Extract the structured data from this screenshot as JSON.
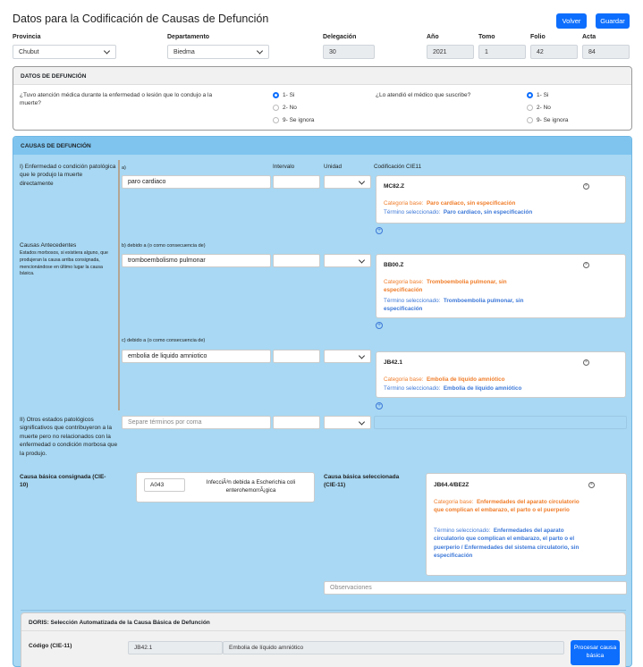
{
  "header": {
    "title": "Datos para la Codificación de Causas de Defunción",
    "volver": "Volver",
    "guardar": "Guardar"
  },
  "top_fields": {
    "provincia": {
      "label": "Provincia",
      "value": "Chubut"
    },
    "departamento": {
      "label": "Departamento",
      "value": "Biedma"
    },
    "delegacion": {
      "label": "Delegación",
      "value": "30"
    },
    "anio": {
      "label": "Año",
      "value": "2021"
    },
    "tomo": {
      "label": "Tomo",
      "value": "1"
    },
    "folio": {
      "label": "Folio",
      "value": "42"
    },
    "acta": {
      "label": "Acta",
      "value": "84"
    }
  },
  "defuncion": {
    "header": "DATOS DE DEFUNCIÓN",
    "q1": "¿Tuvo atención médica durante la enfermedad o lesión que lo condujo a la muerte?",
    "q2": "¿Lo atendió el médico que suscribe?",
    "options": [
      "1- Si",
      "2- No",
      "9- Se ignora"
    ]
  },
  "causas": {
    "header": "CAUSAS DE DEFUNCIÓN",
    "sec1": "I) Enfermedad o condición patológica que le produjo la muerte directamente",
    "sec2_title": "Causas Antecedentes",
    "sec2_desc": "Estados morbosos, si existiera alguno, que produjeran la causa arriba consignada, mencionándose en último lugar la causa básica.",
    "sec3": "II) Otros estados patológicos significativos que contribuyeron a la muerte pero no relacionados con la enfermedad o condición morbosa que la produjo.",
    "col_intervalo": "Intervalo",
    "col_unidad": "Unidad",
    "col_cie": "Codificación CIE11",
    "cat_label": "Categoria base:",
    "term_label": "Término seleccionado:",
    "rows": [
      {
        "sublabel": "a)",
        "value": "paro cardiaco",
        "code": "MC82.Z",
        "cat": "Paro cardiaco, sin especificación",
        "term": "Paro cardiaco, sin especificación"
      },
      {
        "sublabel": "b) debido a (o como consecuencia de)",
        "value": "tromboembolismo pulmonar",
        "code": "BB00.Z",
        "cat": "Tromboembolia pulmonar, sin especificación",
        "term": "Tromboembolia pulmonar, sin especificación"
      },
      {
        "sublabel": "c) debido a (o como consecuencia de)",
        "value": "embolia de liquido amniotico",
        "code": "JB42.1",
        "cat": "Embolia de líquido amniótico",
        "term": "Embolia de líquido amniótico"
      }
    ],
    "otros_placeholder": "Separe términos por coma",
    "basica_consignada_label": "Causa básica consignada (CIE-10)",
    "basica_consignada_code": "A043",
    "basica_consignada_desc": "InfecciÃ³n debida a Escherichia coli enterohemorrÃ¡gica",
    "basica_sel_label": "Causa básica seleccionada (CIE-11)",
    "basica_sel_code": "JB64.4/BE2Z",
    "basica_sel_cat": "Enfermedades del aparato circulatorio que complican el embarazo, el parto o el puerperio",
    "basica_sel_term": "Enfermedades del aparato circulatorio que complican el embarazo, el parto o el puerperio / Enfermedades del sistema circulatorio, sin especificación",
    "observaciones_placeholder": "Observaciones"
  },
  "doris": {
    "header": "DORIS: Selección Automatizada de la Causa Básica de Defunción",
    "codigo_label": "Código (CIE-11)",
    "codigo_value": "JB42.1",
    "desc_value": "Embolia de líquido amniótico",
    "procesar": "Procesar causa básica"
  }
}
